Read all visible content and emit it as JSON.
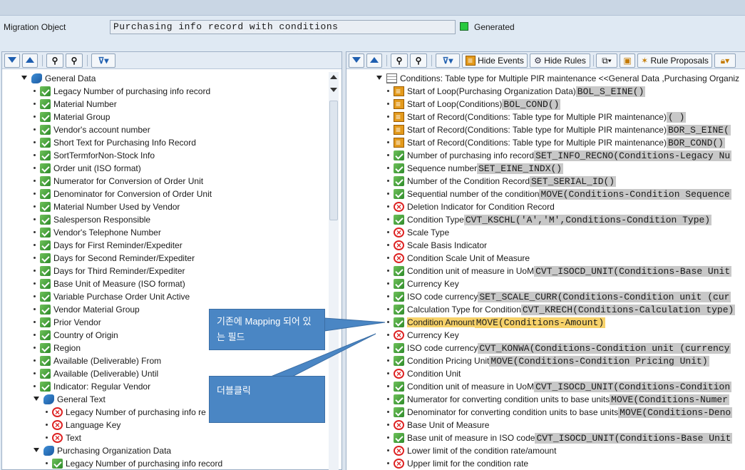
{
  "header": {
    "migration_label": "Migration Object",
    "migration_value": "Purchasing info record with conditions",
    "status_label": "Generated",
    "status_color": "#27c93f"
  },
  "left_toolbar": {
    "icons": [
      "expand-all-icon",
      "collapse-all-icon",
      "find-icon",
      "find-next-icon",
      "filter-icon"
    ]
  },
  "right_toolbar": {
    "hide_events": "Hide Events",
    "hide_rules": "Hide Rules",
    "rule_proposals": "Rule Proposals"
  },
  "left_tree": [
    {
      "label": "General Data",
      "level": 0,
      "icon": "structure",
      "caret": true
    },
    {
      "label": "Legacy Number of purchasing info record",
      "level": 1,
      "icon": "green"
    },
    {
      "label": "Material Number",
      "level": 1,
      "icon": "green"
    },
    {
      "label": "Material Group",
      "level": 1,
      "icon": "green"
    },
    {
      "label": "Vendor's account number",
      "level": 1,
      "icon": "green"
    },
    {
      "label": "Short Text for Purchasing Info Record",
      "level": 1,
      "icon": "green"
    },
    {
      "label": "SortTermforNon-Stock Info",
      "level": 1,
      "icon": "green"
    },
    {
      "label": "Order unit (ISO format)",
      "level": 1,
      "icon": "green"
    },
    {
      "label": "Numerator for Conversion of Order Unit",
      "level": 1,
      "icon": "green"
    },
    {
      "label": "Denominator for Conversion of Order Unit",
      "level": 1,
      "icon": "green"
    },
    {
      "label": "Material Number Used by Vendor",
      "level": 1,
      "icon": "green"
    },
    {
      "label": "Salesperson Responsible",
      "level": 1,
      "icon": "green"
    },
    {
      "label": "Vendor's Telephone Number",
      "level": 1,
      "icon": "green"
    },
    {
      "label": "Days for First Reminder/Expediter",
      "level": 1,
      "icon": "green"
    },
    {
      "label": "Days for Second Reminder/Expediter",
      "level": 1,
      "icon": "green"
    },
    {
      "label": "Days for Third Reminder/Expediter",
      "level": 1,
      "icon": "green"
    },
    {
      "label": "Base Unit of Measure (ISO format)",
      "level": 1,
      "icon": "green"
    },
    {
      "label": "Variable Purchase Order Unit Active",
      "level": 1,
      "icon": "green"
    },
    {
      "label": "Vendor Material Group",
      "level": 1,
      "icon": "green"
    },
    {
      "label": "Prior Vendor",
      "level": 1,
      "icon": "green"
    },
    {
      "label": "Country of Origin",
      "level": 1,
      "icon": "green"
    },
    {
      "label": "Region",
      "level": 1,
      "icon": "green"
    },
    {
      "label": "Available (Deliverable) From",
      "level": 1,
      "icon": "green"
    },
    {
      "label": "Available (Deliverable) Until",
      "level": 1,
      "icon": "green"
    },
    {
      "label": "Indicator: Regular Vendor",
      "level": 1,
      "icon": "green"
    },
    {
      "label": "General Text",
      "level": 1,
      "icon": "structure",
      "caret": true
    },
    {
      "label": "Legacy Number of purchasing info re",
      "level": 2,
      "icon": "red"
    },
    {
      "label": "Language Key",
      "level": 2,
      "icon": "red"
    },
    {
      "label": "Text",
      "level": 2,
      "icon": "red"
    },
    {
      "label": "Purchasing Organization Data",
      "level": 1,
      "icon": "structure",
      "caret": true
    },
    {
      "label": "Legacy Number of purchasing info record",
      "level": 2,
      "icon": "green"
    }
  ],
  "right_tree": [
    {
      "label": "Conditions: Table type for Multiple PIR maintenance <<General Data ,Purchasing Organiz",
      "icon": "table",
      "caret": true,
      "code": ""
    },
    {
      "label": "Start of Loop(Purchasing Organization Data)",
      "icon": "orange",
      "code": "BOL_S_EINE()"
    },
    {
      "label": "Start of Loop(Conditions)",
      "icon": "orange",
      "code": "BOL_COND()"
    },
    {
      "label": "Start of Record(Conditions: Table type for Multiple PIR maintenance)",
      "icon": "orange",
      "code": "( )"
    },
    {
      "label": "Start of Record(Conditions: Table type for Multiple PIR maintenance)",
      "icon": "orange",
      "code": "BOR_S_EINE("
    },
    {
      "label": "Start of Record(Conditions: Table type for Multiple PIR maintenance)",
      "icon": "orange",
      "code": "BOR_COND()"
    },
    {
      "label": "Number of purchasing info record",
      "icon": "green",
      "code": "SET_INFO_RECNO(Conditions-Legacy Nu"
    },
    {
      "label": "Sequence number",
      "icon": "green",
      "code": "SET_EINE_INDX()"
    },
    {
      "label": "Number of the Condition Record",
      "icon": "green",
      "code": "SET_SERIAL_ID()"
    },
    {
      "label": "Sequential number of the condition",
      "icon": "green",
      "code": "MOVE(Conditions-Condition Sequence"
    },
    {
      "label": "Deletion Indicator for Condition Record",
      "icon": "red",
      "code": ""
    },
    {
      "label": "Condition Type",
      "icon": "green",
      "code": "CVT_KSCHL('A','M',Conditions-Condition Type)"
    },
    {
      "label": "Scale Type",
      "icon": "red",
      "code": ""
    },
    {
      "label": "Scale Basis Indicator",
      "icon": "red",
      "code": ""
    },
    {
      "label": "Condition Scale Unit of Measure",
      "icon": "red",
      "code": ""
    },
    {
      "label": "Condition unit of measure in UoM",
      "icon": "green",
      "code": "CVT_ISOCD_UNIT(Conditions-Base Unit"
    },
    {
      "label": "Currency Key",
      "icon": "green",
      "code": ""
    },
    {
      "label": "ISO code currency",
      "icon": "green",
      "code": "SET_SCALE_CURR(Conditions-Condition unit (cur"
    },
    {
      "label": "Calculation Type for Condition",
      "icon": "green",
      "code": "CVT_KRECH(Conditions-Calculation type)"
    },
    {
      "label": "Condition Amount",
      "icon": "green",
      "code": "MOVE(Conditions-Amount)",
      "highlight": true
    },
    {
      "label": "Currency Key",
      "icon": "red",
      "code": ""
    },
    {
      "label": "ISO code currency",
      "icon": "green",
      "code": "CVT_KONWA(Conditions-Condition unit (currency"
    },
    {
      "label": "Condition Pricing Unit",
      "icon": "green",
      "code": "MOVE(Conditions-Condition Pricing Unit)"
    },
    {
      "label": "Condition Unit",
      "icon": "red",
      "code": ""
    },
    {
      "label": "Condition unit of measure in UoM",
      "icon": "green",
      "code": "CVT_ISOCD_UNIT(Conditions-Condition"
    },
    {
      "label": "Numerator for converting condition units to base units",
      "icon": "green",
      "code": "MOVE(Conditions-Numer"
    },
    {
      "label": "Denominator for converting condition units to base units",
      "icon": "green",
      "code": "MOVE(Conditions-Deno"
    },
    {
      "label": "Base Unit of Measure",
      "icon": "red",
      "code": ""
    },
    {
      "label": "Base unit of measure in ISO code",
      "icon": "green",
      "code": "CVT_ISOCD_UNIT(Conditions-Base Unit"
    },
    {
      "label": "Lower limit of the condition rate/amount",
      "icon": "red",
      "code": ""
    },
    {
      "label": "Upper limit for the condition rate",
      "icon": "red",
      "code": ""
    }
  ],
  "annotations": {
    "mapped_field_note": "기존에 Mapping 되어 있는 필드",
    "double_click_note": "더블클릭"
  }
}
